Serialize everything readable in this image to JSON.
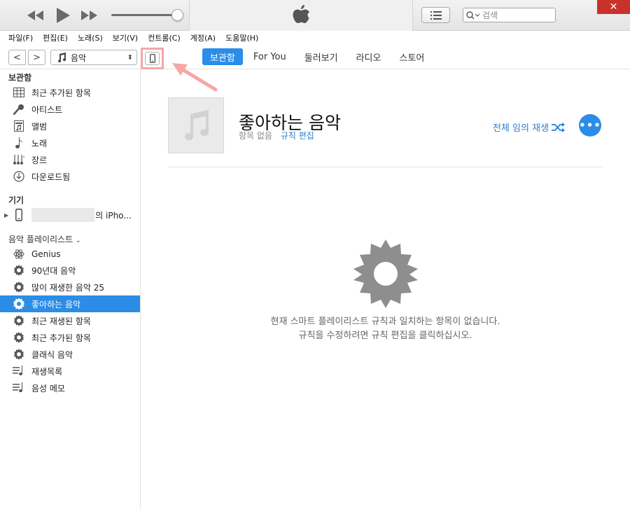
{
  "menu": [
    "파일(F)",
    "편집(E)",
    "노래(S)",
    "보기(V)",
    "컨트롤(C)",
    "계정(A)",
    "도움말(H)"
  ],
  "search": {
    "placeholder": "검색"
  },
  "close_glyph": "✕",
  "nav": {
    "back": "<",
    "forward": ">",
    "media_select": "음악",
    "tabs": [
      "보관함",
      "For You",
      "둘러보기",
      "라디오",
      "스토어"
    ],
    "active_tab": 0
  },
  "sidebar": {
    "library_title": "보관함",
    "library_items": [
      {
        "label": "최근 추가된 항목",
        "icon": "grid-icon"
      },
      {
        "label": "아티스트",
        "icon": "microphone-icon"
      },
      {
        "label": "앨범",
        "icon": "album-icon"
      },
      {
        "label": "노래",
        "icon": "note-icon"
      },
      {
        "label": "장르",
        "icon": "genre-icon"
      },
      {
        "label": "다운로드됨",
        "icon": "download-icon"
      }
    ],
    "devices_title": "기기",
    "device_name": "의 iPho...",
    "playlists_title": "음악 플레이리스트",
    "playlist_items": [
      {
        "label": "Genius",
        "icon": "genius-icon",
        "selected": false
      },
      {
        "label": "90년대 음악",
        "icon": "smart-gear-icon",
        "selected": false
      },
      {
        "label": "많이 재생한 음악 25",
        "icon": "smart-gear-icon",
        "selected": false
      },
      {
        "label": "좋아하는 음악",
        "icon": "smart-gear-icon",
        "selected": true
      },
      {
        "label": "최근 재생된 항목",
        "icon": "smart-gear-icon",
        "selected": false
      },
      {
        "label": "최근 추가된 항목",
        "icon": "smart-gear-icon",
        "selected": false
      },
      {
        "label": "클래식 음악",
        "icon": "smart-gear-icon",
        "selected": false
      },
      {
        "label": "재생목록",
        "icon": "playlist-icon",
        "selected": false
      },
      {
        "label": "음성 메모",
        "icon": "playlist-icon",
        "selected": false
      }
    ]
  },
  "main": {
    "title": "좋아하는 음악",
    "meta": "항목 없음",
    "edit_rules": "규칙 편집",
    "shuffle_all": "전체 임의 재생",
    "more": "•••",
    "empty_line1": "현재 스마트 플레이리스트 규칙과 일치하는 항목이 없습니다.",
    "empty_line2": "규칙을 수정하려면 규칙 편집을 클릭하십시오."
  },
  "colors": {
    "accent": "#2b8de6",
    "highlight": "#f6a6a6",
    "close": "#c9322b"
  }
}
